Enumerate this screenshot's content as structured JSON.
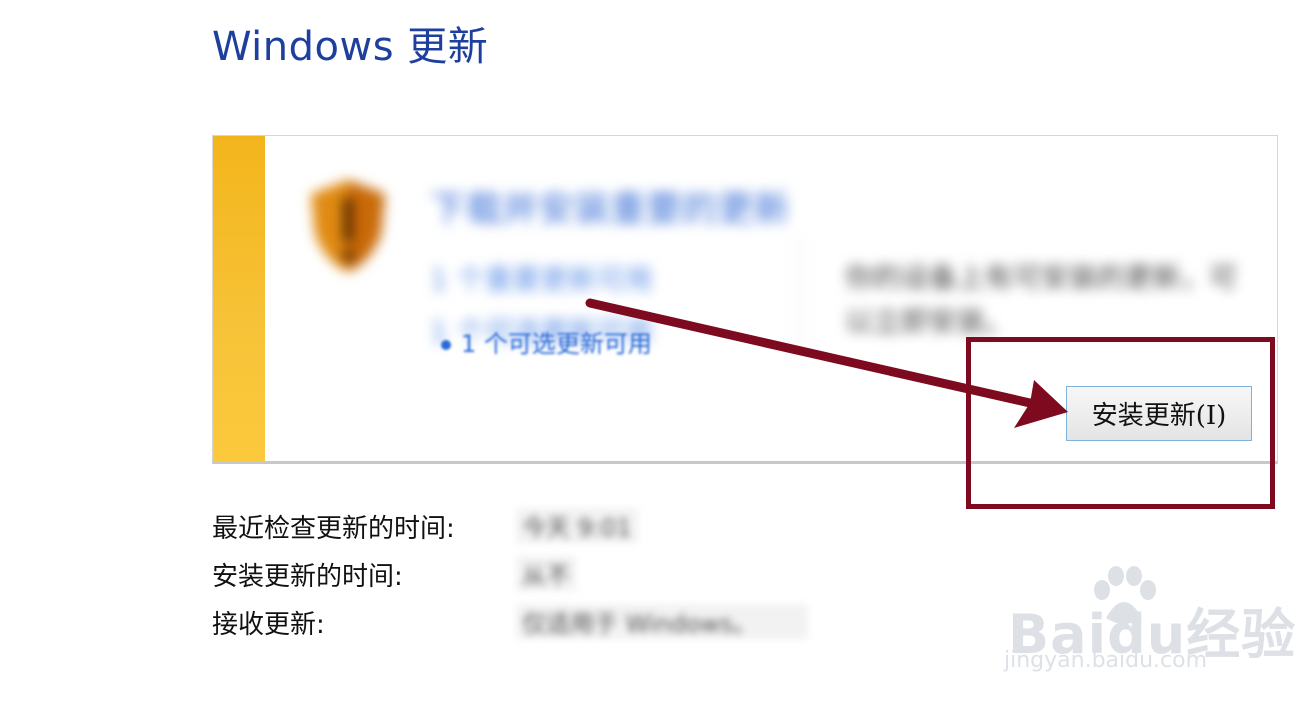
{
  "page": {
    "title": "Windows 更新"
  },
  "update_panel": {
    "headline": "下载并安装重要的更新",
    "link_important": "1 个重要更新可用",
    "link_optional": "1 个可选更新可用",
    "description": "你的设备上有可安装的更新，可以立即安装。",
    "install_button_label": "安装更新(I)",
    "stripe_color": "#f3b51c"
  },
  "info": {
    "last_check_label": "最近检查更新的时间:",
    "last_check_value": "今天 9:01",
    "installed_label": "安装更新的时间:",
    "installed_value": "从不",
    "receive_label": "接收更新:",
    "receive_value": "仅适用于 Windows。"
  },
  "annotation": {
    "color": "#7d0a1e"
  },
  "watermark": {
    "brand": "Baidu经验",
    "url": "jingyan.baidu.com"
  }
}
